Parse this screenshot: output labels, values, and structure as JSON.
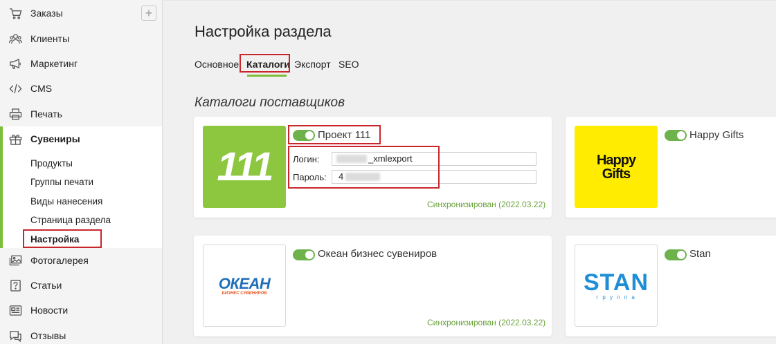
{
  "sidebar": {
    "items": [
      {
        "label": "Заказы",
        "icon": "cart-icon"
      },
      {
        "label": "Клиенты",
        "icon": "users-icon"
      },
      {
        "label": "Маркетинг",
        "icon": "megaphone-icon"
      },
      {
        "label": "CMS",
        "icon": "code-icon"
      },
      {
        "label": "Печать",
        "icon": "printer-icon"
      },
      {
        "label": "Сувениры",
        "icon": "gift-icon"
      },
      {
        "label": "Фотогалерея",
        "icon": "image-icon"
      },
      {
        "label": "Статьи",
        "icon": "question-icon"
      },
      {
        "label": "Новости",
        "icon": "news-icon"
      },
      {
        "label": "Отзывы",
        "icon": "speech-icon"
      }
    ],
    "submenu": [
      "Продукты",
      "Группы печати",
      "Виды нанесения",
      "Страница раздела",
      "Настройка"
    ],
    "add_label": "+"
  },
  "page": {
    "title": "Настройка раздела",
    "tabs": [
      "Основное",
      "Каталоги",
      "Экспорт",
      "SEO"
    ],
    "active_tab": "Каталоги",
    "section_title": "Каталоги поставщиков"
  },
  "suppliers": [
    {
      "name": "Проект 111",
      "enabled": true,
      "logo_text": "111",
      "login_label": "Логин:",
      "login_value": "_xmlexport",
      "password_label": "Пароль:",
      "password_value": "4",
      "sync": "Синхронизирован (2022.03.22)"
    },
    {
      "name": "Happy Gifts",
      "enabled": true,
      "logo_text": [
        "Happy",
        "Gifts"
      ]
    },
    {
      "name": "Океан бизнес сувениров",
      "enabled": true,
      "logo_text": [
        "ОКЕАН",
        "БИЗНЕС СУВЕНИРОВ"
      ],
      "sync": "Синхронизирован (2022.03.22)"
    },
    {
      "name": "Stan",
      "enabled": true,
      "logo_text": [
        "STAN",
        "г р у п п а"
      ]
    }
  ],
  "colors": {
    "accent": "#7dbf3a",
    "highlight": "#c8262b",
    "logo111_bg": "#8dc63f",
    "happy_bg": "#ffec00",
    "ocean_blue": "#1f6fb8",
    "ocean_orange": "#e8541e",
    "stan_blue": "#1e8fd6"
  }
}
